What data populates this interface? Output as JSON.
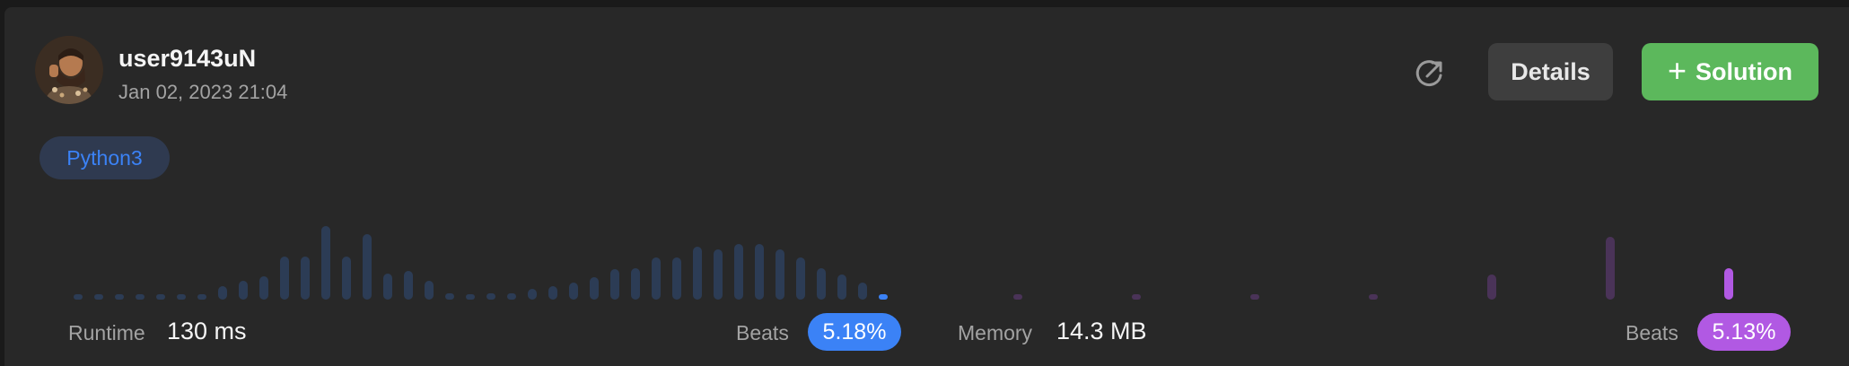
{
  "user": {
    "username": "user9143uN",
    "timestamp": "Jan 02, 2023 21:04"
  },
  "actions": {
    "share_icon": "share-icon",
    "details_label": "Details",
    "solution_label": "Solution",
    "solution_icon": "plus-icon"
  },
  "language": "Python3",
  "runtime": {
    "label": "Runtime",
    "value": "130 ms",
    "beats_label": "Beats",
    "beats_value": "5.18%",
    "color": "#3b82f6"
  },
  "memory": {
    "label": "Memory",
    "value": "14.3 MB",
    "beats_label": "Beats",
    "beats_value": "5.13%",
    "color": "#b159e3"
  },
  "chart_data": [
    {
      "type": "bar",
      "metric": "runtime distribution",
      "values": [
        2,
        2,
        2,
        2,
        2,
        2,
        2,
        10,
        14,
        18,
        33,
        33,
        56,
        33,
        50,
        20,
        22,
        14,
        5,
        4,
        5,
        5,
        8,
        10,
        13,
        17,
        23,
        24,
        32,
        32,
        40,
        38,
        42,
        42,
        38,
        32,
        24,
        19,
        13,
        3
      ],
      "highlight_index": 39,
      "highlight_color": "#3b82f6",
      "base_color": "#2c3c55"
    },
    {
      "type": "bar",
      "metric": "memory distribution",
      "values": [
        1,
        1,
        1,
        1,
        19,
        48,
        24
      ],
      "highlight_index": 6,
      "highlight_color": "#b159e3",
      "base_color": "#4a3358"
    }
  ]
}
